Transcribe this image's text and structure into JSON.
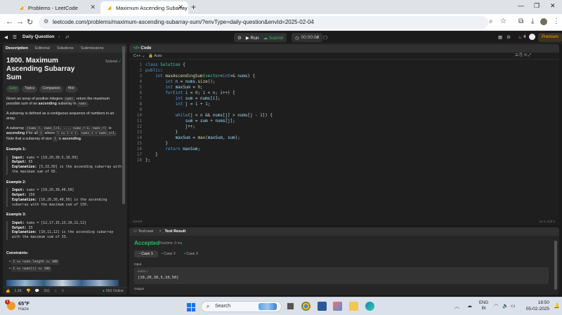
{
  "browser": {
    "tabs": [
      {
        "label": "Problems - LeetCode"
      },
      {
        "label": "Maximum Ascending Subarray"
      }
    ],
    "url": "leetcode.com/problems/maximum-ascending-subarray-sum/?envType=daily-question&envId=2025-02-04"
  },
  "lc_header": {
    "daily": "Daily Question",
    "run": "Run",
    "submit": "Submit",
    "timer": "00:00:04",
    "streak": "4",
    "premium": "Premium"
  },
  "left": {
    "tabs": [
      "Description",
      "Editorial",
      "Solutions",
      "Submissions"
    ],
    "title": "1800. Maximum Ascending Subarray Sum",
    "solved": "Solved",
    "tags": [
      "Easy",
      "Topics",
      "Companies",
      "Hint"
    ],
    "para1_a": "Given an array of positive integers ",
    "para1_code": "nums",
    "para1_b": ", return the ",
    "para1_c": "maximum possible sum",
    "para1_d": " of an ",
    "para1_e": "ascending",
    "para1_f": " subarray in ",
    "para1_code2": "nums",
    "para1_g": ".",
    "para2": "A subarray is defined as a contiguous sequence of numbers in an array.",
    "para3_a": "A subarray ",
    "para3_code": "[nums_l, nums_l+1, ..., nums_r-1, nums_r]",
    "para3_b": " is ",
    "para3_c": "ascending",
    "para3_d": " if for all ",
    "para3_code2": "i",
    "para3_e": " where ",
    "para3_code3": "l <= i < r",
    "para3_f": ", ",
    "para3_code4": "nums_i < nums_i+1",
    "para3_g": ". Note that a subarray of size ",
    "para3_code5": "1",
    "para3_h": " is ",
    "para3_i": "ascending",
    "para3_j": ".",
    "examples": [
      {
        "h": "Example 1:",
        "input": "nums = [10,20,30,5,10,50]",
        "output": "65",
        "expl": "[5,10,50] is the ascending subarray with the maximum sum of 65."
      },
      {
        "h": "Example 2:",
        "input": "nums = [10,20,30,40,50]",
        "output": "150",
        "expl": "[10,20,30,40,50] is the ascending subarray with the maximum sum of 150."
      },
      {
        "h": "Example 3:",
        "input": "nums = [12,17,15,13,10,11,12]",
        "output": "33",
        "expl": "[10,11,12] is the ascending subarray with the maximum sum of 33."
      }
    ],
    "labels": {
      "input": "Input:",
      "output": "Output:",
      "explanation": "Explanation:"
    },
    "constraints_h": "Constraints:",
    "constraints": [
      "1 <= nums.length <= 100",
      "1 <= nums[i] <= 100"
    ],
    "footer": {
      "likes": "1.2K",
      "comments": "202",
      "online": "991 Online"
    }
  },
  "code": {
    "header": "Code",
    "lang": "C++",
    "mode": "Auto",
    "saved": "Saved",
    "cursor": "Ln 1, Col 1",
    "line_numbers": [
      "1",
      "2",
      "3",
      "4",
      "5",
      "6",
      "7",
      "8",
      "9",
      "10",
      "11",
      "12",
      "13",
      "14",
      "15",
      "16",
      "17",
      "18"
    ]
  },
  "result": {
    "tabs": [
      "Testcase",
      "Test Result"
    ],
    "status": "Accepted",
    "runtime": "Runtime: 0 ms",
    "cases": [
      "Case 1",
      "Case 2",
      "Case 3"
    ],
    "input_label": "Input",
    "var_name": "nums =",
    "var_value": "[10,20,30,5,10,50]",
    "output_label": "Output"
  },
  "taskbar": {
    "temp": "65°F",
    "weather": "Haze",
    "notif": "1",
    "search": "Search",
    "lang1": "ENG",
    "lang2": "IN",
    "time": "18:50",
    "date": "05-02-2025"
  },
  "colors": {
    "accepted": "#2cbb5d",
    "leetcode_orange": "#ffa116",
    "submit_green": "#2cbb5d"
  }
}
